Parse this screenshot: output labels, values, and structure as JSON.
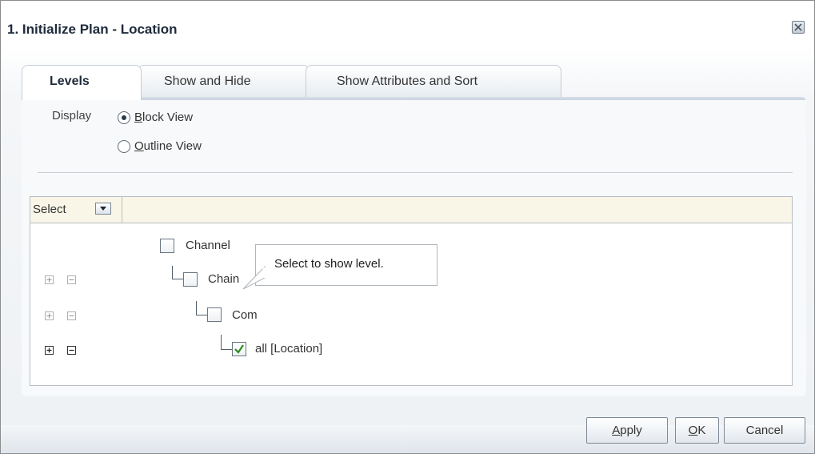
{
  "dialog": {
    "title": "1. Initialize Plan - Location"
  },
  "tabs": [
    {
      "label": "Levels",
      "active": true
    },
    {
      "label": "Show and Hide",
      "active": false
    },
    {
      "label": "Show Attributes and Sort",
      "active": false
    }
  ],
  "display": {
    "label": "Display",
    "options": [
      {
        "mnemonic": "B",
        "rest": "lock View",
        "checked": true
      },
      {
        "mnemonic": "O",
        "rest": "utline View",
        "checked": false
      }
    ]
  },
  "grid": {
    "select_label": "Select",
    "rows": [
      {
        "label": "Channel",
        "checked": false
      },
      {
        "label": "Chain",
        "checked": false
      },
      {
        "label": "Com",
        "checked": false
      },
      {
        "label": "all [Location]",
        "checked": true
      }
    ]
  },
  "tooltip": {
    "text": "Select to show level."
  },
  "buttons": {
    "apply": {
      "mnemonic": "A",
      "rest": "pply"
    },
    "ok": {
      "mnemonic": "O",
      "rest": "K"
    },
    "cancel": {
      "label": "Cancel"
    }
  },
  "colors": {
    "check_green": "#2e8b1e",
    "header_bg": "#f9f6e8",
    "tab_strip": "#c8d3df"
  }
}
